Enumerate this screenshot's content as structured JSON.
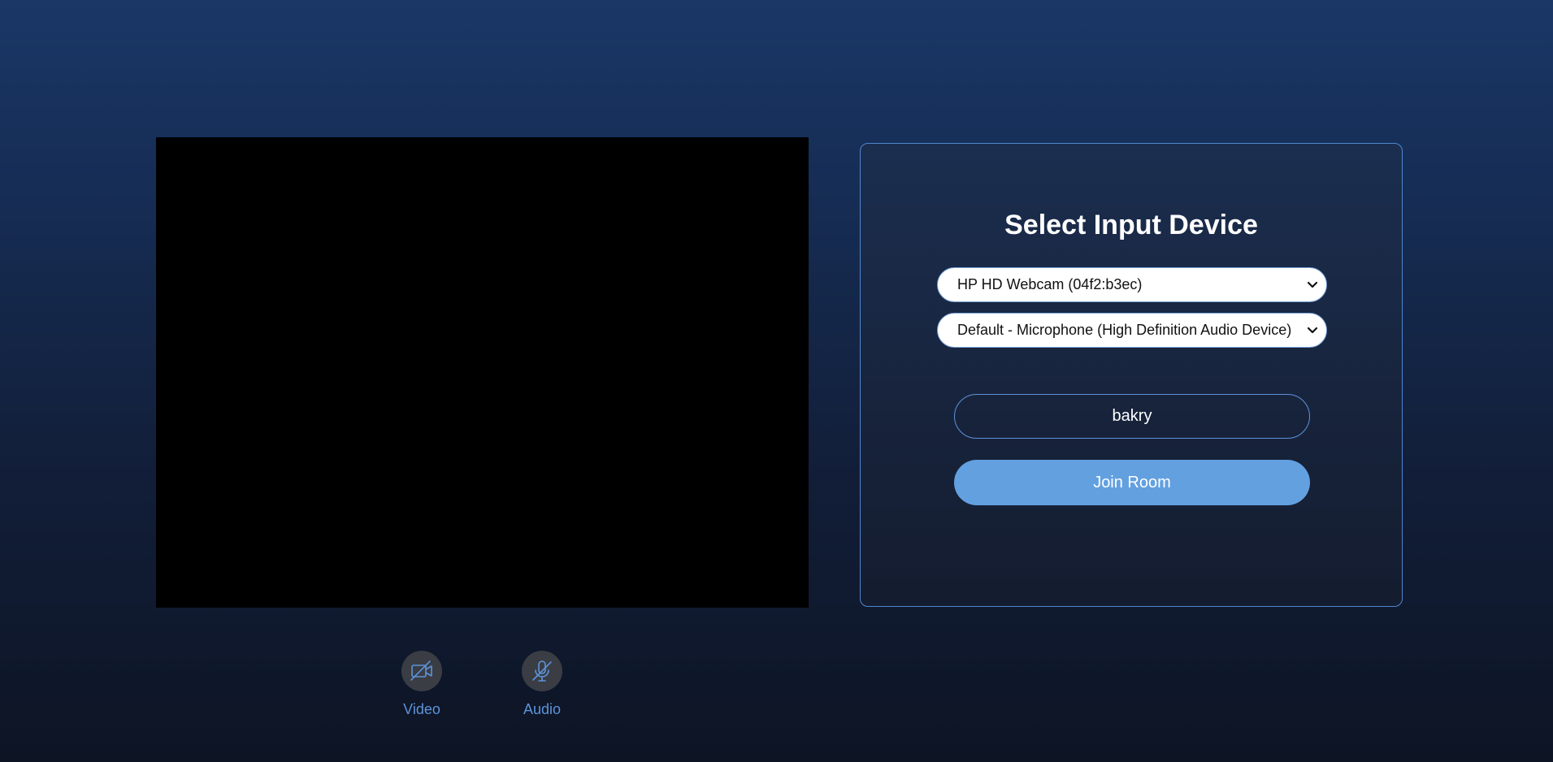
{
  "preview": {
    "controls": [
      {
        "label": "Video",
        "icon": "video-off-icon"
      },
      {
        "label": "Audio",
        "icon": "microphone-off-icon"
      }
    ]
  },
  "device_panel": {
    "title": "Select Input Device",
    "camera_select": {
      "selected": "HP HD Webcam (04f2:b3ec)"
    },
    "microphone_select": {
      "selected": "Default - Microphone (High Definition Audio Device)"
    },
    "name_input": {
      "value": "bakry"
    },
    "join_label": "Join Room"
  },
  "colors": {
    "accent": "#62a0e0",
    "border": "#4f86cf",
    "toggle_bg": "#3a3d44",
    "preview_bg": "#000000"
  }
}
